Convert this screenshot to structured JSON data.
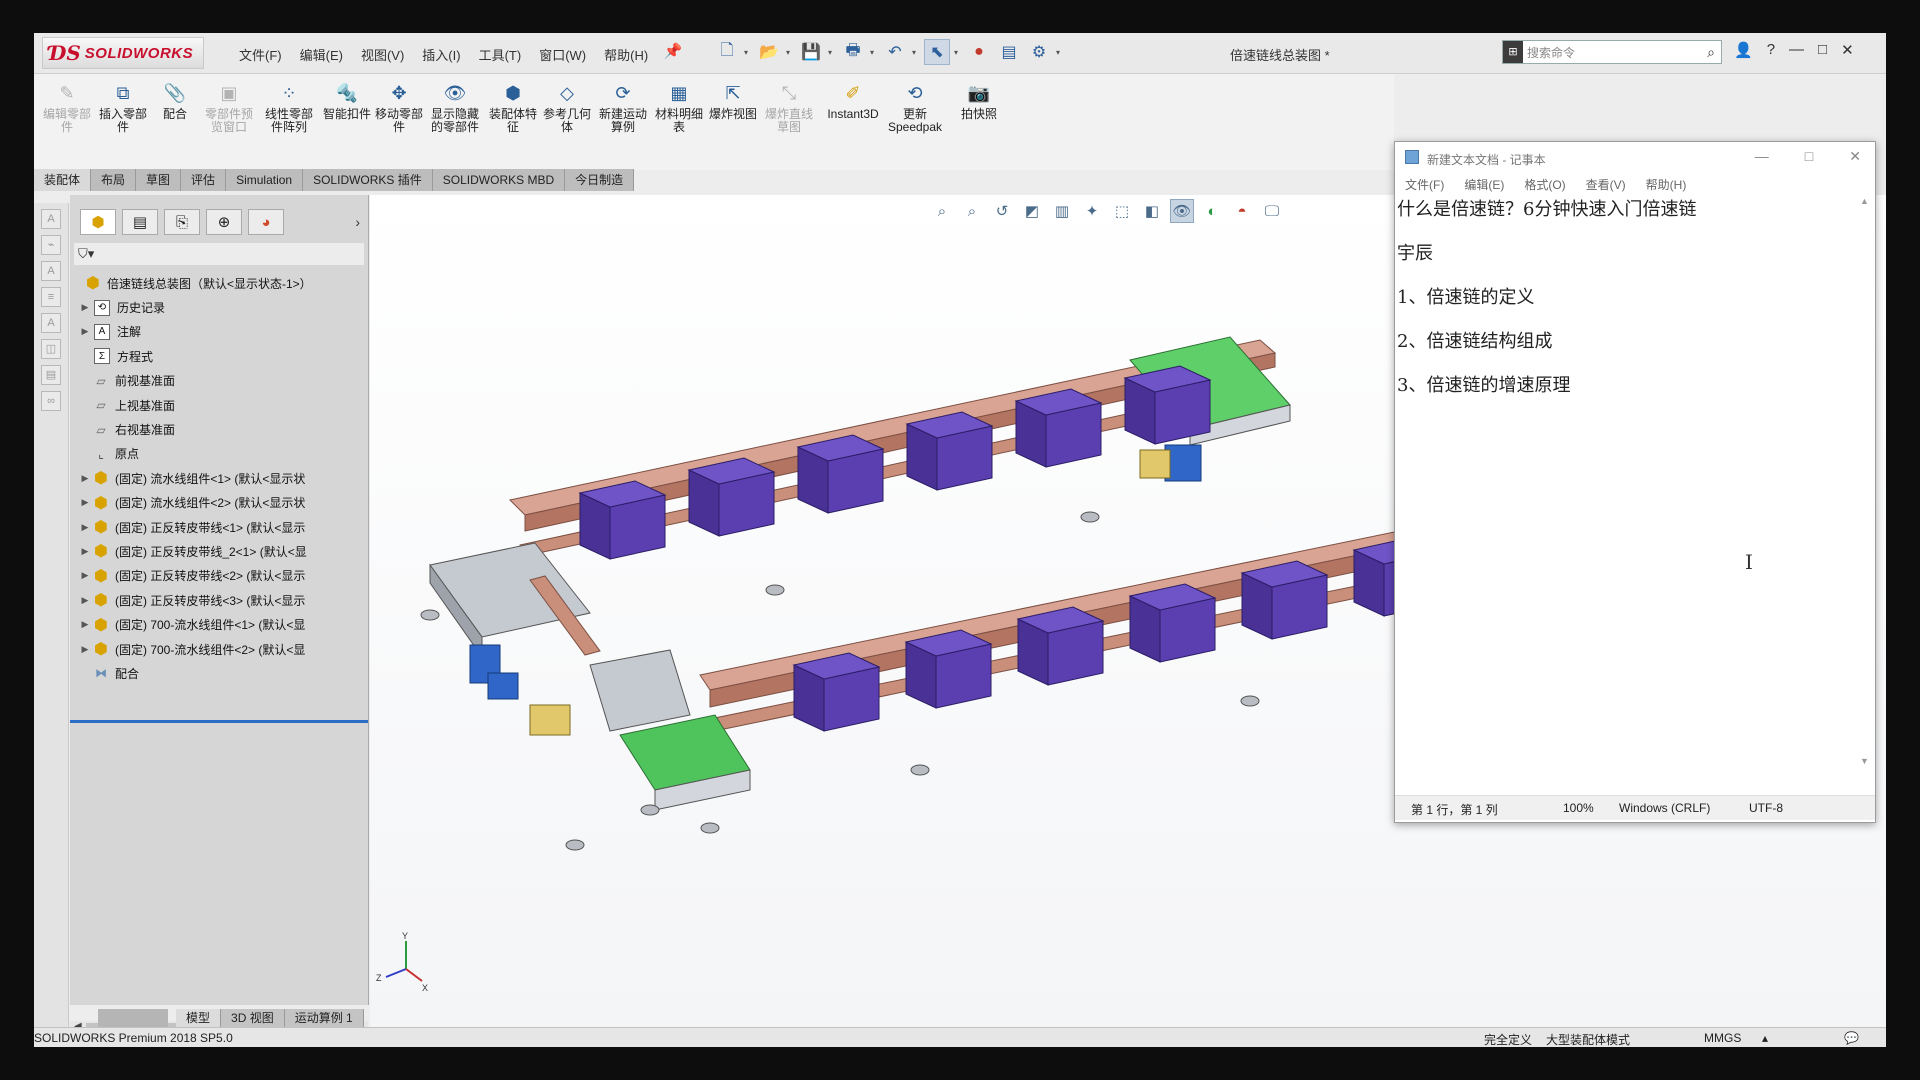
{
  "app": {
    "logo_text": "SOLIDWORKS",
    "document_title": "倍速链线总装图 *",
    "search_placeholder": "搜索命令",
    "menus": [
      "文件(F)",
      "编辑(E)",
      "视图(V)",
      "插入(I)",
      "工具(T)",
      "窗口(W)",
      "帮助(H)"
    ]
  },
  "ribbon": {
    "buttons": [
      {
        "label": "编辑零部件",
        "disabled": true
      },
      {
        "label": "插入零部件",
        "disabled": false
      },
      {
        "label": "配合",
        "disabled": false
      },
      {
        "label": "零部件预览窗口",
        "disabled": true
      },
      {
        "label": "线性零部件阵列",
        "disabled": false
      },
      {
        "label": "智能扣件",
        "disabled": false
      },
      {
        "label": "移动零部件",
        "disabled": false
      },
      {
        "label": "显示隐藏的零部件",
        "disabled": false
      },
      {
        "label": "装配体特征",
        "disabled": false
      },
      {
        "label": "参考几何体",
        "disabled": false
      },
      {
        "label": "新建运动算例",
        "disabled": false
      },
      {
        "label": "材料明细表",
        "disabled": false
      },
      {
        "label": "爆炸视图",
        "disabled": false
      },
      {
        "label": "爆炸直线草图",
        "disabled": true
      },
      {
        "label": "Instant3D",
        "disabled": false
      },
      {
        "label": "更新Speedpak",
        "disabled": false
      },
      {
        "label": "拍快照",
        "disabled": false
      }
    ]
  },
  "tabs": [
    {
      "label": "装配体",
      "active": true
    },
    {
      "label": "布局"
    },
    {
      "label": "草图"
    },
    {
      "label": "评估"
    },
    {
      "label": "Simulation"
    },
    {
      "label": "SOLIDWORKS 插件"
    },
    {
      "label": "SOLIDWORKS MBD"
    },
    {
      "label": "今日制造"
    }
  ],
  "tree": {
    "root": "倍速链线总装图（默认<显示状态-1>）",
    "items": [
      {
        "label": "历史记录",
        "expandable": true
      },
      {
        "label": "注解",
        "expandable": true
      },
      {
        "label": "方程式",
        "expandable": false
      },
      {
        "label": "前视基准面",
        "expandable": false
      },
      {
        "label": "上视基准面",
        "expandable": false
      },
      {
        "label": "右视基准面",
        "expandable": false
      },
      {
        "label": "原点",
        "expandable": false
      },
      {
        "label": "(固定) 流水线组件<1> (默认<显示状",
        "expandable": true
      },
      {
        "label": "(固定) 流水线组件<2> (默认<显示状",
        "expandable": true
      },
      {
        "label": "(固定) 正反转皮带线<1> (默认<显示",
        "expandable": true
      },
      {
        "label": "(固定) 正反转皮带线_2<1> (默认<显",
        "expandable": true
      },
      {
        "label": "(固定) 正反转皮带线<2> (默认<显示",
        "expandable": true
      },
      {
        "label": "(固定) 正反转皮带线<3> (默认<显示",
        "expandable": true
      },
      {
        "label": "(固定) 700-流水线组件<1> (默认<显",
        "expandable": true
      },
      {
        "label": "(固定) 700-流水线组件<2> (默认<显",
        "expandable": true
      },
      {
        "label": "配合",
        "expandable": false
      }
    ]
  },
  "bottom_tabs": [
    "模型",
    "3D 视图",
    "运动算例 1"
  ],
  "status": {
    "product": "SOLIDWORKS Premium 2018 SP5.0",
    "state": "完全定义",
    "mode": "大型装配体模式",
    "units": "MMGS"
  },
  "notepad": {
    "title": "新建文本文档 - 记事本",
    "menus": [
      "文件(F)",
      "编辑(E)",
      "格式(O)",
      "查看(V)",
      "帮助(H)"
    ],
    "lines": [
      "什么是倍速链？6分钟快速入门倍速链",
      "宇辰",
      "1、倍速链的定义",
      "2、倍速链结构组成",
      "3、倍速链的增速原理"
    ],
    "status": {
      "position": "第 1 行，第 1 列",
      "zoom": "100%",
      "line_ending": "Windows (CRLF)",
      "encoding": "UTF-8"
    }
  },
  "colors": {
    "brand": "#c8102e",
    "selection": "#2a6cc6",
    "payload": "#5b3fb0",
    "rail": "#c98f7a",
    "belt_green": "#5fcf6a",
    "motor_blue": "#2f66c8"
  }
}
